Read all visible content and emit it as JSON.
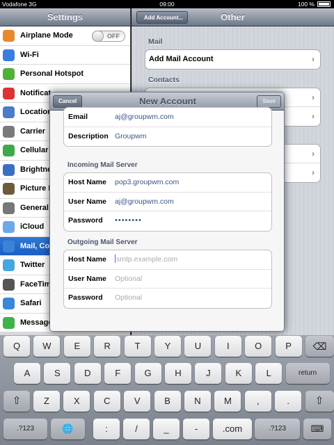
{
  "status_bar": {
    "carrier": "Vodafone 3G",
    "time": "09:00",
    "battery": "100 %"
  },
  "master": {
    "title": "Settings",
    "airplane_toggle": "OFF",
    "items": [
      {
        "label": "Airplane Mode",
        "icon": "airplane-icon",
        "color": "#e9882c"
      },
      {
        "label": "Wi-Fi",
        "icon": "wifi-icon",
        "color": "#3b7de0"
      },
      {
        "label": "Personal Hotspot",
        "icon": "hotspot-icon",
        "color": "#4fb13b"
      },
      {
        "label": "Notificat",
        "icon": "notifications-icon",
        "color": "#d33"
      },
      {
        "label": "Location",
        "icon": "location-icon",
        "color": "#4a7cc9"
      },
      {
        "label": "Carrier",
        "icon": "carrier-icon",
        "color": "#7a7a7a"
      },
      {
        "label": "Cellular",
        "icon": "cellular-icon",
        "color": "#3fa84b"
      },
      {
        "label": "Brightne",
        "icon": "brightness-icon",
        "color": "#3b6fc4"
      },
      {
        "label": "Picture F",
        "icon": "picture-frame-icon",
        "color": "#6c5a3a"
      },
      {
        "label": "General",
        "icon": "gear-icon",
        "color": "#777"
      },
      {
        "label": "iCloud",
        "icon": "icloud-icon",
        "color": "#6aaae8"
      },
      {
        "label": "Mail, Co",
        "icon": "mail-icon",
        "color": "#3b83d8"
      },
      {
        "label": "Twitter",
        "icon": "twitter-icon",
        "color": "#46a7e0"
      },
      {
        "label": "FaceTim",
        "icon": "facetime-icon",
        "color": "#555"
      },
      {
        "label": "Safari",
        "icon": "safari-icon",
        "color": "#3a86d8"
      },
      {
        "label": "Message",
        "icon": "messages-icon",
        "color": "#3fb24a"
      }
    ]
  },
  "detail": {
    "back": "Add Account...",
    "title": "Other",
    "section_mail": "Mail",
    "add_mail": "Add Mail Account",
    "section_contacts": "Contacts"
  },
  "modal": {
    "title": "New Account",
    "cancel": "Cancel",
    "save": "Save",
    "email_label": "Email",
    "email_value": "aj@groupwm.com",
    "description_label": "Description",
    "description_value": "Groupwm",
    "incoming_header": "Incoming Mail Server",
    "in_host_label": "Host Name",
    "in_host_value": "pop3.groupwm.com",
    "in_user_label": "User Name",
    "in_user_value": "aj@groupwm.com",
    "in_pass_label": "Password",
    "in_pass_value": "••••••••",
    "outgoing_header": "Outgoing Mail Server",
    "out_host_label": "Host Name",
    "out_host_placeholder": "smtp.example.com",
    "out_user_label": "User Name",
    "out_user_placeholder": "Optional",
    "out_pass_label": "Password",
    "out_pass_placeholder": "Optional"
  },
  "keyboard": {
    "row1": [
      "Q",
      "W",
      "E",
      "R",
      "T",
      "Y",
      "U",
      "I",
      "O",
      "P"
    ],
    "row2": [
      "A",
      "S",
      "D",
      "F",
      "G",
      "H",
      "J",
      "K",
      "L"
    ],
    "row3": [
      "Z",
      "X",
      "C",
      "V",
      "B",
      "N",
      "M",
      ",",
      "."
    ],
    "row4": [
      ":",
      "/",
      "_",
      "-",
      ".com"
    ],
    "return": "return",
    "numbers": ".?123"
  }
}
